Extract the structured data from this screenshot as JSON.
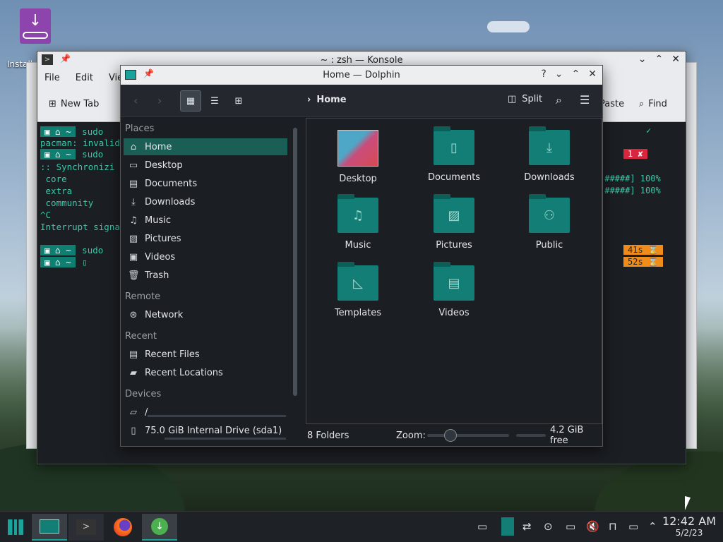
{
  "desktop": {
    "icon_label": "Install"
  },
  "konsole": {
    "title": "~ : zsh — Konsole",
    "menu": [
      "File",
      "Edit",
      "View"
    ],
    "toolbar": {
      "new_tab": "New Tab",
      "paste": "Paste",
      "find": "Find"
    },
    "lines": [
      "pacman: invalid",
      ":: Synchronizi",
      " core",
      " extra",
      " community",
      "^C",
      "Interrupt signa"
    ],
    "prompt_cmd": "sudo",
    "right": {
      "check": "✓",
      "err": "1 ✘",
      "prog1": "[#####] 100%",
      "prog2": "[#####] 100%",
      "t1": "41s ⌛",
      "t2": "52s ⌛"
    }
  },
  "dolphin": {
    "title": "Home — Dolphin",
    "breadcrumb": "Home",
    "split_label": "Split",
    "places": {
      "heading": "Places",
      "items": [
        "Home",
        "Desktop",
        "Documents",
        "Downloads",
        "Music",
        "Pictures",
        "Videos",
        "Trash"
      ]
    },
    "remote": {
      "heading": "Remote",
      "items": [
        "Network"
      ]
    },
    "recent": {
      "heading": "Recent",
      "items": [
        "Recent Files",
        "Recent Locations"
      ]
    },
    "devices": {
      "heading": "Devices",
      "items": [
        "/",
        "75.0 GiB Internal Drive (sda1)"
      ]
    },
    "folders": [
      "Desktop",
      "Documents",
      "Downloads",
      "Music",
      "Pictures",
      "Public",
      "Templates",
      "Videos"
    ],
    "status": {
      "count": "8 Folders",
      "zoom_label": "Zoom:",
      "free": "4.2 GiB free"
    }
  },
  "taskbar": {
    "time": "12:42 AM",
    "date": "5/2/23"
  }
}
